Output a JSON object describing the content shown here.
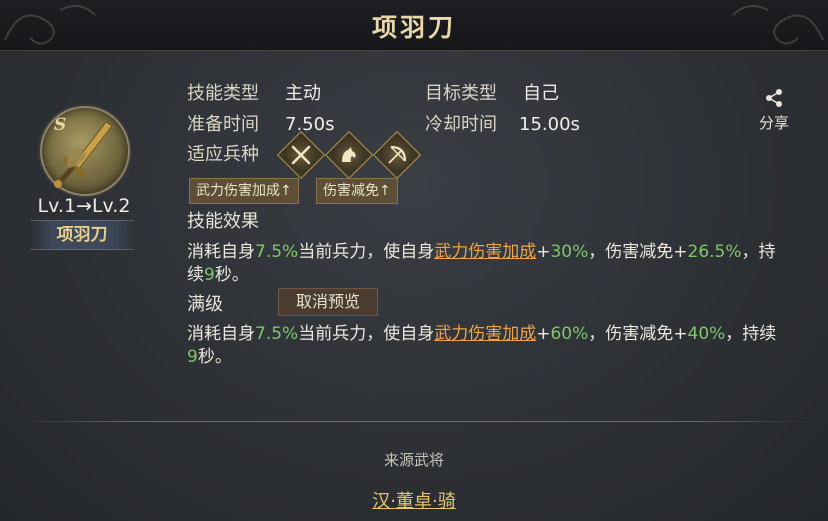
{
  "title": "项羽刀",
  "skill": {
    "grade": "S",
    "level_text": "Lv.1→Lv.2",
    "name": "项羽刀"
  },
  "info": {
    "skill_type_label": "技能类型",
    "skill_type_value": "主动",
    "target_type_label": "目标类型",
    "target_type_value": "自己",
    "prep_time_label": "准备时间",
    "prep_time_value": "7.50s",
    "cooldown_label": "冷却时间",
    "cooldown_value": "15.00s",
    "troop_label": "适应兵种",
    "troop_icons": [
      "crossed-spears-icon",
      "horse-icon",
      "bow-icon"
    ]
  },
  "tags": [
    "武力伤害加成↑",
    "伤害减免↑"
  ],
  "effect": {
    "label": "技能效果",
    "line1": {
      "p1": "消耗自身",
      "n1": "7.5%",
      "p2": "当前兵力，使自身",
      "link": "武力伤害加成",
      "p3": "+",
      "n2": "30%",
      "p4": "，伤害减免+",
      "n3": "26.5%",
      "p5": "，持",
      "p6": "续",
      "n4": "9",
      "p7": "秒。"
    }
  },
  "max_level": {
    "label": "满级",
    "cancel_button": "取消预览",
    "line": {
      "p1": "消耗自身",
      "n1": "7.5%",
      "p2": "当前兵力，使自身",
      "link": "武力伤害加成",
      "p3": "+",
      "n2": "60%",
      "p4": "，伤害减免+",
      "n3": "40%",
      "p5": "，持续",
      "n4": "9",
      "p6": "秒。"
    }
  },
  "share_label": "分享",
  "source": {
    "label": "来源武将",
    "general": "汉·董卓·骑"
  },
  "colors": {
    "highlight_green": "#7fc86a",
    "link_orange": "#f0a34a",
    "title_gold": "#e9d7a8"
  }
}
